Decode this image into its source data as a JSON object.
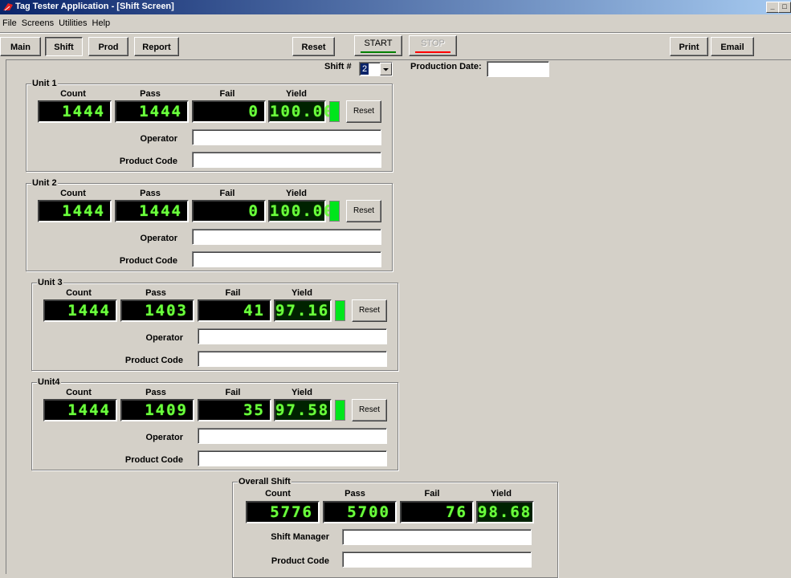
{
  "window": {
    "title": "Tag Tester Application - [Shift Screen]",
    "controls": [
      "_",
      "□"
    ]
  },
  "menu": [
    "File",
    "Screens",
    "Utilities",
    "Help"
  ],
  "toolbar": {
    "main": "Main",
    "shift": "Shift",
    "prod": "Prod",
    "report": "Report",
    "reset": "Reset",
    "start": "START",
    "stop": "STOP",
    "print": "Print",
    "email": "Email"
  },
  "shift_selector": {
    "label": "Shift #",
    "value": "2",
    "production_date_label": "Production Date:",
    "production_date_value": ""
  },
  "headers": {
    "count": "Count",
    "pass": "Pass",
    "fail": "Fail",
    "yield": "Yield"
  },
  "labels": {
    "operator": "Operator",
    "product_code": "Product Code",
    "reset": "Reset",
    "shift_manager": "Shift Manager"
  },
  "units": [
    {
      "name": "Unit 1",
      "count": "1444",
      "pass": "1444",
      "fail": "0",
      "yield": "100.00",
      "operator": "",
      "product_code": ""
    },
    {
      "name": "Unit 2",
      "count": "1444",
      "pass": "1444",
      "fail": "0",
      "yield": "100.00",
      "operator": "",
      "product_code": ""
    },
    {
      "name": "Unit 3",
      "count": "1444",
      "pass": "1403",
      "fail": "41",
      "yield": "97.16",
      "operator": "",
      "product_code": ""
    },
    {
      "name": "Unit4",
      "count": "1444",
      "pass": "1409",
      "fail": "35",
      "yield": "97.58",
      "operator": "",
      "product_code": ""
    }
  ],
  "overall": {
    "name": "Overall Shift",
    "count": "5776",
    "pass": "5700",
    "fail": "76",
    "yield": "98.68",
    "shift_manager": "",
    "product_code": ""
  },
  "colors": {
    "lcd_digit": "#6cff3e",
    "indicator": "#00e61c",
    "start_underline": "#008000",
    "stop_underline": "#ff0000"
  }
}
